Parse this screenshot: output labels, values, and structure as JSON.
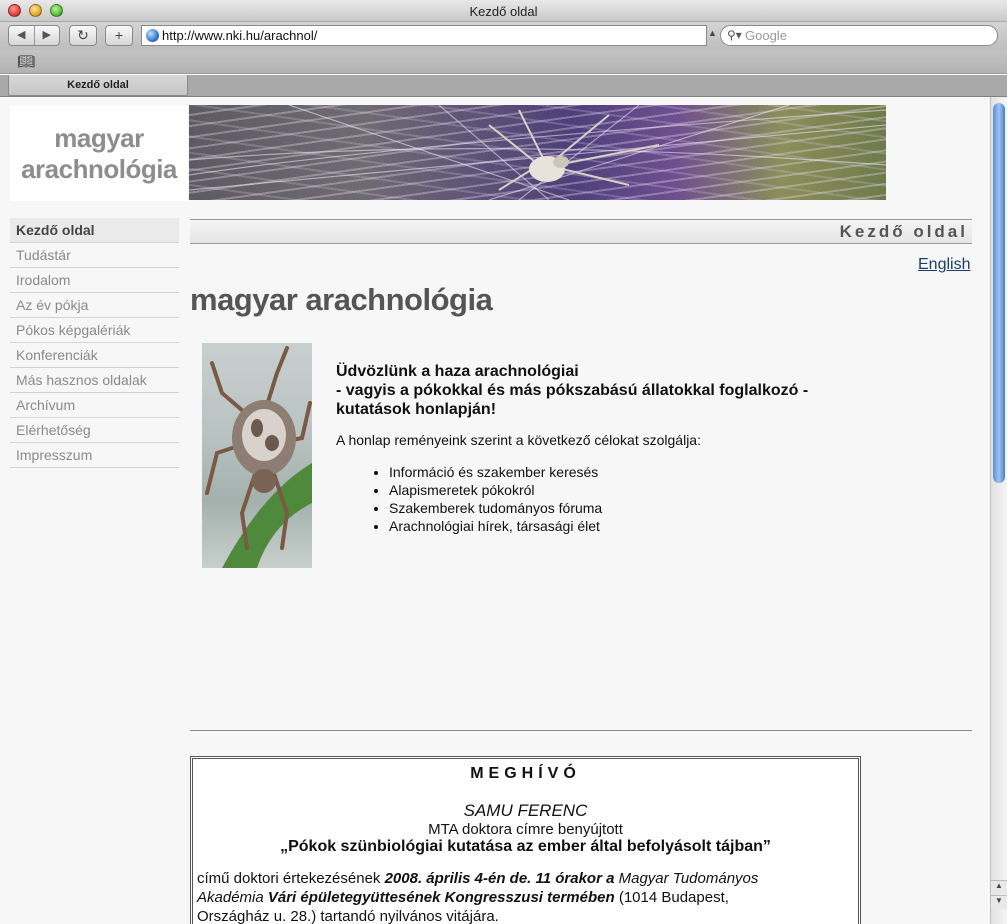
{
  "window": {
    "title": "Kezdő oldal"
  },
  "browser": {
    "url": "http://www.nki.hu/arachnol/",
    "search_placeholder": "Google",
    "tab_label": "Kezdő oldal",
    "icons": [
      "back-icon",
      "forward-icon",
      "reload-icon",
      "add-bookmark-icon",
      "globe-icon",
      "search-icon",
      "bookmarks-book-icon"
    ]
  },
  "logo": {
    "line1": "magyar",
    "line2": "arachnológia"
  },
  "sidebar": {
    "items": [
      {
        "label": "Kezdő oldal",
        "active": true
      },
      {
        "label": "Tudástár"
      },
      {
        "label": "Irodalom"
      },
      {
        "label": "Az év pókja"
      },
      {
        "label": "Pókos képgalériák"
      },
      {
        "label": "Konferenciák"
      },
      {
        "label": "Más hasznos oldalak"
      },
      {
        "label": "Archívum"
      },
      {
        "label": "Elérhetőség"
      },
      {
        "label": "Impresszum"
      }
    ]
  },
  "page": {
    "section_heading": "Kezdő oldal",
    "english_link": "English",
    "title": "magyar arachnológia",
    "welcome_line1": "Üdvözlünk a haza arachnológiai",
    "welcome_line2": "- vagyis a pókokkal és más pókszabású állatokkal foglalkozó -",
    "welcome_line3": "kutatások honlapján!",
    "intro": "A honlap reményeink szerint a következő célokat szolgálja:",
    "goals": [
      "Információ és szakember keresés",
      "Alapismeretek pókokról",
      "Szakemberek tudományos fóruma",
      "Arachnológiai hírek, társasági élet"
    ]
  },
  "invitation": {
    "heading": "MEGHÍVÓ",
    "name": "SAMU FERENC",
    "subtitle": "MTA doktora címre benyújtott",
    "thesis": "„Pókok szünbiológiai kutatása az ember által befolyásolt tájban”",
    "body_1": "című doktori értekezésének ",
    "body_2": "2008. április 4-én de. 11 órakor a",
    "body_3": " Magyar Tudományos Akadémia ",
    "body_4": "Vári épületegyüttesének Kongresszusi termében",
    "body_5": " (1014 Budapest, Országház u. 28.) tartandó nyilvános vitájára."
  }
}
